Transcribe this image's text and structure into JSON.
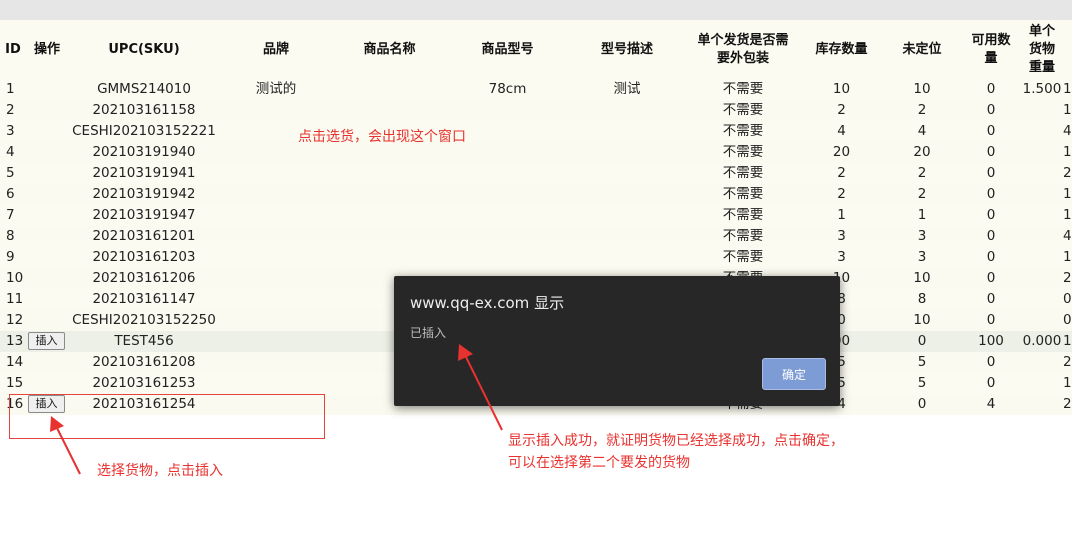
{
  "headers": [
    "ID",
    "操作",
    "UPC(SKU)",
    "品牌",
    "商品名称",
    "商品型号",
    "型号描述",
    "单个发货是否需要外包装",
    "库存数量",
    "未定位",
    "可用数量",
    "单个货物重量"
  ],
  "rows": [
    {
      "id": "1",
      "sku": "GMMS214010",
      "brand": "测试的",
      "name": "",
      "model": "78cm",
      "desc": "测试",
      "pack": "不需要",
      "stock": "10",
      "unloc": "10",
      "avail": "0",
      "weight": "1.500",
      "extra": "1"
    },
    {
      "id": "2",
      "sku": "202103161158",
      "brand": "",
      "name": "",
      "model": "",
      "desc": "",
      "pack": "不需要",
      "stock": "2",
      "unloc": "2",
      "avail": "0",
      "weight": "",
      "extra": "1"
    },
    {
      "id": "3",
      "sku": "CESHI202103152221",
      "brand": "",
      "name": "",
      "model": "",
      "desc": "",
      "pack": "不需要",
      "stock": "4",
      "unloc": "4",
      "avail": "0",
      "weight": "",
      "extra": "4"
    },
    {
      "id": "4",
      "sku": "202103191940",
      "brand": "",
      "name": "",
      "model": "",
      "desc": "",
      "pack": "不需要",
      "stock": "20",
      "unloc": "20",
      "avail": "0",
      "weight": "",
      "extra": "1"
    },
    {
      "id": "5",
      "sku": "202103191941",
      "brand": "",
      "name": "",
      "model": "",
      "desc": "",
      "pack": "不需要",
      "stock": "2",
      "unloc": "2",
      "avail": "0",
      "weight": "",
      "extra": "2"
    },
    {
      "id": "6",
      "sku": "202103191942",
      "brand": "",
      "name": "",
      "model": "",
      "desc": "",
      "pack": "不需要",
      "stock": "2",
      "unloc": "2",
      "avail": "0",
      "weight": "",
      "extra": "1"
    },
    {
      "id": "7",
      "sku": "202103191947",
      "brand": "",
      "name": "",
      "model": "",
      "desc": "",
      "pack": "不需要",
      "stock": "1",
      "unloc": "1",
      "avail": "0",
      "weight": "",
      "extra": "1"
    },
    {
      "id": "8",
      "sku": "202103161201",
      "brand": "",
      "name": "",
      "model": "",
      "desc": "",
      "pack": "不需要",
      "stock": "3",
      "unloc": "3",
      "avail": "0",
      "weight": "",
      "extra": "4"
    },
    {
      "id": "9",
      "sku": "202103161203",
      "brand": "",
      "name": "",
      "model": "",
      "desc": "",
      "pack": "不需要",
      "stock": "3",
      "unloc": "3",
      "avail": "0",
      "weight": "",
      "extra": "1"
    },
    {
      "id": "10",
      "sku": "202103161206",
      "brand": "",
      "name": "",
      "model": "",
      "desc": "",
      "pack": "不需要",
      "stock": "10",
      "unloc": "10",
      "avail": "0",
      "weight": "",
      "extra": "2"
    },
    {
      "id": "11",
      "sku": "202103161147",
      "brand": "",
      "name": "",
      "model": "",
      "desc": "",
      "pack": "",
      "stock": "8",
      "unloc": "8",
      "avail": "0",
      "weight": "",
      "extra": "0"
    },
    {
      "id": "12",
      "sku": "CESHI202103152250",
      "brand": "",
      "name": "",
      "model": "",
      "desc": "",
      "pack": "",
      "stock": "0",
      "unloc": "10",
      "avail": "0",
      "weight": "",
      "extra": "0"
    },
    {
      "id": "13",
      "sku": "TEST456",
      "brand": "",
      "name": "",
      "model": "",
      "desc": "",
      "pack": "",
      "stock": "00",
      "unloc": "0",
      "avail": "100",
      "weight": "0.000",
      "extra": "1",
      "insert": true
    },
    {
      "id": "14",
      "sku": "202103161208",
      "brand": "",
      "name": "",
      "model": "",
      "desc": "",
      "pack": "",
      "stock": "5",
      "unloc": "5",
      "avail": "0",
      "weight": "",
      "extra": "2"
    },
    {
      "id": "15",
      "sku": "202103161253",
      "brand": "",
      "name": "",
      "model": "",
      "desc": "",
      "pack": "",
      "stock": "5",
      "unloc": "5",
      "avail": "0",
      "weight": "",
      "extra": "1"
    },
    {
      "id": "16",
      "sku": "202103161254",
      "brand": "",
      "name": "",
      "model": "",
      "desc": "",
      "pack": "不需要",
      "stock": "4",
      "unloc": "0",
      "avail": "4",
      "weight": "",
      "extra": "2",
      "insert": true
    }
  ],
  "insert_label": "插入",
  "dialog": {
    "title": "www.qq-ex.com 显示",
    "message": "已插入",
    "ok_label": "确定"
  },
  "annotations": {
    "select_tip": "点击选货，会出现这个窗口",
    "insert_tip": "选择货物，点击插入",
    "success_tip_line1": "显示插入成功，就证明货物已经选择成功，点击确定，",
    "success_tip_line2": "可以在选择第二个要发的货物"
  },
  "colors": {
    "annotation": "#e8322f",
    "dialog_bg": "#272727",
    "ok_button": "#7d9bd5",
    "table_bg": "#fbfbf1"
  }
}
